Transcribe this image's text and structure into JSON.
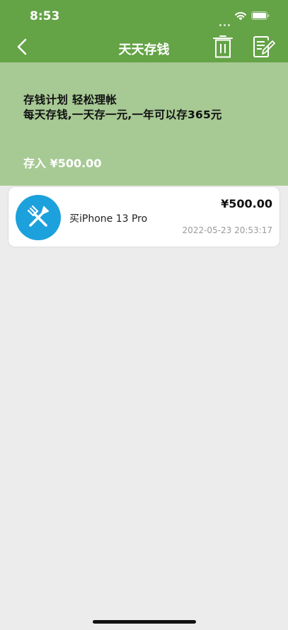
{
  "status_bar": {
    "time": "8:53"
  },
  "nav": {
    "title": "天天存钱"
  },
  "banner": {
    "line1": "存钱计划 轻松理帐",
    "line2": "每天存钱,一天存一元,一年可以存365元",
    "deposit": "存入 ¥500.00"
  },
  "records": [
    {
      "icon": "fork-knife-icon",
      "name": "买iPhone 13 Pro",
      "amount": "¥500.00",
      "time": "2022-05-23 20:53:17"
    }
  ],
  "colors": {
    "header": "#64a346",
    "banner": "#a7c994",
    "icon_bg": "#1da1dc",
    "background": "#ececec"
  }
}
